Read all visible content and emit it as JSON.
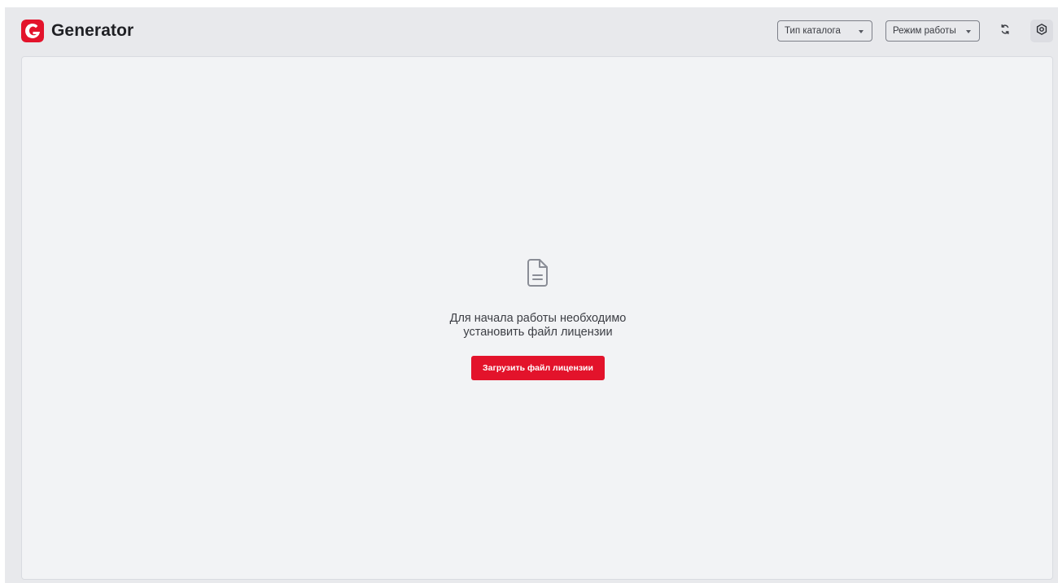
{
  "app": {
    "name": "Generator",
    "logo_letter": "G",
    "brand_color": "#e3132b"
  },
  "toolbar": {
    "catalog_type": {
      "label": "Тип каталога",
      "icon": "chevron-down-icon"
    },
    "work_mode": {
      "label": "Режим работы",
      "icon": "chevron-down-icon"
    },
    "sync_icon": "sync-icon",
    "settings_icon": "gear-icon"
  },
  "empty_state": {
    "icon": "document-icon",
    "message_line1": "Для начала работы необходимо",
    "message_line2": "установить файл лицензии",
    "button_label": "Загрузить файл лицензии"
  }
}
